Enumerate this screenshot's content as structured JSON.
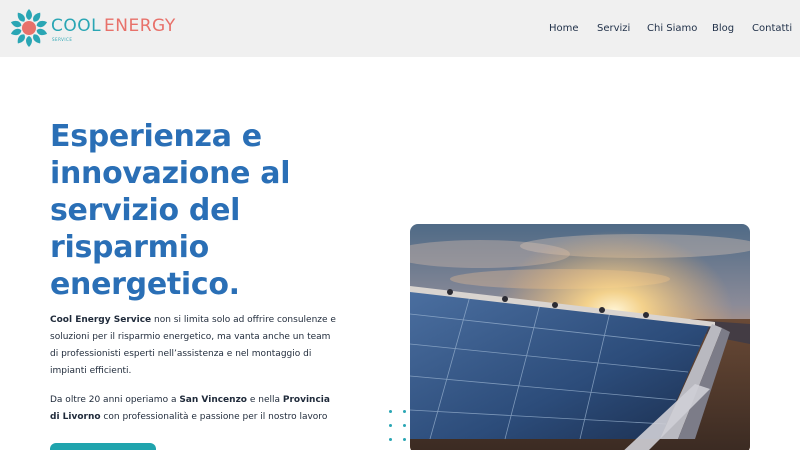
{
  "brand": {
    "word1": "COOL",
    "word2": "ENERGY",
    "tagline": "SERVICE",
    "colors": {
      "teal": "#2aa6b4",
      "coral": "#e8716a"
    }
  },
  "nav": {
    "items": [
      {
        "label": "Home"
      },
      {
        "label": "Servizi"
      },
      {
        "label": "Chi Siamo"
      },
      {
        "label": "Blog"
      },
      {
        "label": "Contatti"
      }
    ]
  },
  "hero": {
    "headline_lines": [
      "Esperienza e",
      "innovazione al",
      "servizio del",
      "risparmio",
      "energetico."
    ],
    "paragraph1": {
      "bold": "Cool Energy Service",
      "text": " non si limita solo ad offrire consulenze e soluzioni per il risparmio energetico, ma vanta anche un team di professionisti esperti nell’assistenza e nel montaggio di impianti efficienti."
    },
    "paragraph2": {
      "t1": "Da oltre 20 anni operiamo a ",
      "b1": "San Vincenzo",
      "t2": " e nella ",
      "b2": "Provincia di Livorno",
      "t3": " con professionalità e passione per il nostro lavoro"
    },
    "image": "solar-panels-sunset-photo",
    "accent_color": "#2a6fb6",
    "cta_color": "#1fa4ad"
  }
}
